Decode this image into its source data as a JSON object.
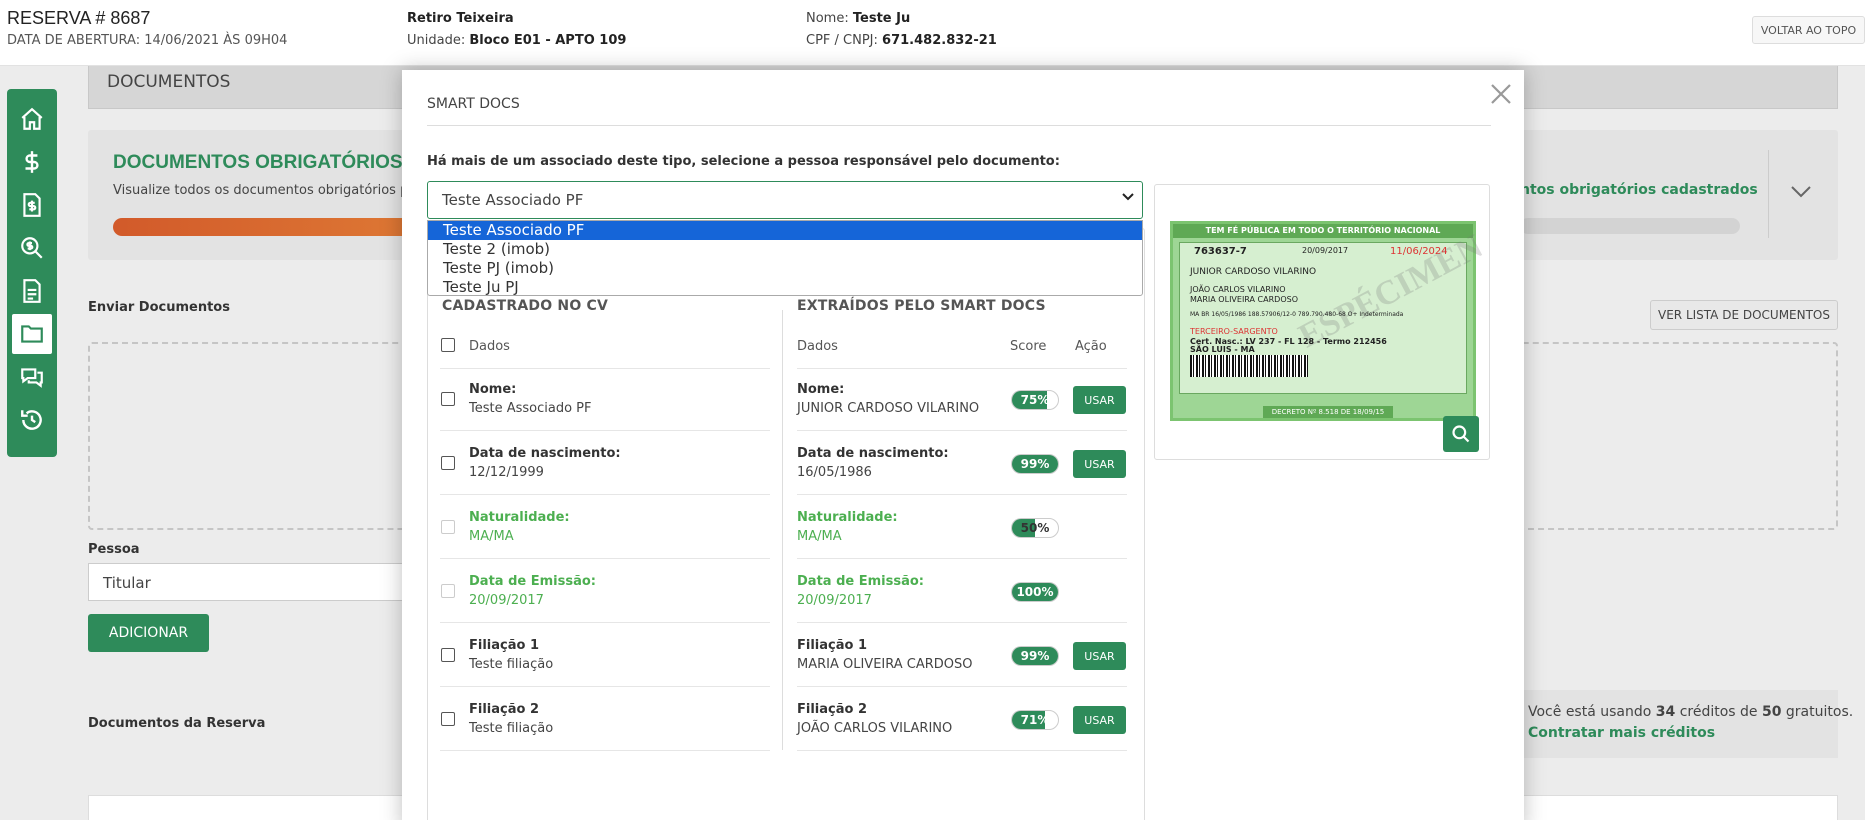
{
  "header": {
    "reserva_title": "RESERVA # 8687",
    "data_abertura": "DATA DE ABERTURA: 14/06/2021 ÀS 09H04",
    "empreendimento": "Retiro Teixeira",
    "unidade_label": "Unidade:",
    "unidade_value": "Bloco E01 - APTO 109",
    "nome_label": "Nome:",
    "nome_value": "Teste Ju",
    "cpf_label": "CPF / CNPJ:",
    "cpf_value": "671.482.832-21",
    "voltar_label": "VOLTAR AO TOPO"
  },
  "sidebar": {
    "items": [
      "home-icon",
      "dollar-icon",
      "invoice-icon",
      "search-document-icon",
      "document-icon",
      "folder-icon",
      "chat-icon",
      "history-icon"
    ],
    "active_index": 5
  },
  "background": {
    "section_title": "DOCUMENTOS",
    "obrigatorios_title": "DOCUMENTOS OBRIGATÓRIOS",
    "obrigatorios_subtitle": "Visualize todos os documentos obrigatórios para",
    "obrigatorios_right": "ntos obrigatórios cadastrados",
    "enviar_label": "Enviar Documentos",
    "ver_lista_label": "VER LISTA DE DOCUMENTOS",
    "pessoa_label": "Pessoa",
    "pessoa_value": "Titular",
    "adicionar_label": "ADICIONAR",
    "docs_reserva_label": "Documentos da Reserva",
    "credits_prefix": "Você está usando ",
    "credits_used": "34",
    "credits_mid": " créditos de ",
    "credits_total": "50",
    "credits_suffix": " gratuitos.",
    "contratar_label": "Contratar mais créditos"
  },
  "modal": {
    "title": "SMART DOCS",
    "question": "Há mais de um associado deste tipo, selecione a pessoa responsável pelo documento:",
    "select_value": "Teste Associado PF",
    "options": [
      "Teste Associado PF",
      "Teste 2 (imob)",
      "Teste PJ (imob)",
      "Teste Ju PJ"
    ],
    "selected_index": 0,
    "col_left_title": "CADASTRADO NO CV",
    "col_right_title": "EXTRAÍDOS PELO SMART DOCS",
    "hdr_dados": "Dados",
    "hdr_score": "Score",
    "hdr_acao": "Ação",
    "usar_label": "USAR",
    "rows": [
      {
        "label": "Nome:",
        "cv": "Teste Associado PF",
        "smart": "JUNIOR CARDOSO VILARINO",
        "score": "75%",
        "score_pct": 75,
        "green": false,
        "has_button": true
      },
      {
        "label": "Data de nascimento:",
        "cv": "12/12/1999",
        "smart": "16/05/1986",
        "score": "99%",
        "score_pct": 99,
        "green": false,
        "has_button": true
      },
      {
        "label": "Naturalidade:",
        "cv": "MA/MA",
        "smart": "MA/MA",
        "score": "50%",
        "score_pct": 50,
        "green": true,
        "has_button": false
      },
      {
        "label": "Data de Emissão:",
        "cv": "20/09/2017",
        "smart": "20/09/2017",
        "score": "100%",
        "score_pct": 100,
        "green": true,
        "has_button": false
      },
      {
        "label": "Filiação 1",
        "cv": "Teste filiação",
        "smart": "MARIA OLIVEIRA CARDOSO",
        "score": "99%",
        "score_pct": 99,
        "green": false,
        "has_button": true
      },
      {
        "label": "Filiação 2",
        "cv": "Teste filiação",
        "smart": "JOÃO CARLOS VILARINO",
        "score": "71%",
        "score_pct": 71,
        "green": false,
        "has_button": true
      }
    ]
  },
  "document_image": {
    "top_banner": "TEM FÉ PÚBLICA EM TODO O TERRITÓRIO NACIONAL",
    "registro": "763637-7",
    "data_expedicao": "20/09/2017",
    "data_validade": "11/06/2024",
    "nome": "JUNIOR CARDOSO VILARINO",
    "pai": "JOÃO CARLOS VILARINO",
    "mae": "MARIA OLIVEIRA CARDOSO",
    "linha_dados": "MA  BR  16/05/1986   188.57906/12-0   789.790.480-68   O+   Indeterminada",
    "cargo": "TERCEIRO-SARGENTO",
    "certidao": "Cert. Nasc.: LV 237 - FL 128 - Termo 212456",
    "cidade": "SÃO LUIS - MA",
    "stamp": "ESPÉCIMEN",
    "bottom_banner": "DECRETO Nº 8.518 DE 18/09/15"
  },
  "colors": {
    "brand_green": "#2e8b5a",
    "select_highlight": "#1565d8",
    "progress_orange": "#d25a2a"
  }
}
